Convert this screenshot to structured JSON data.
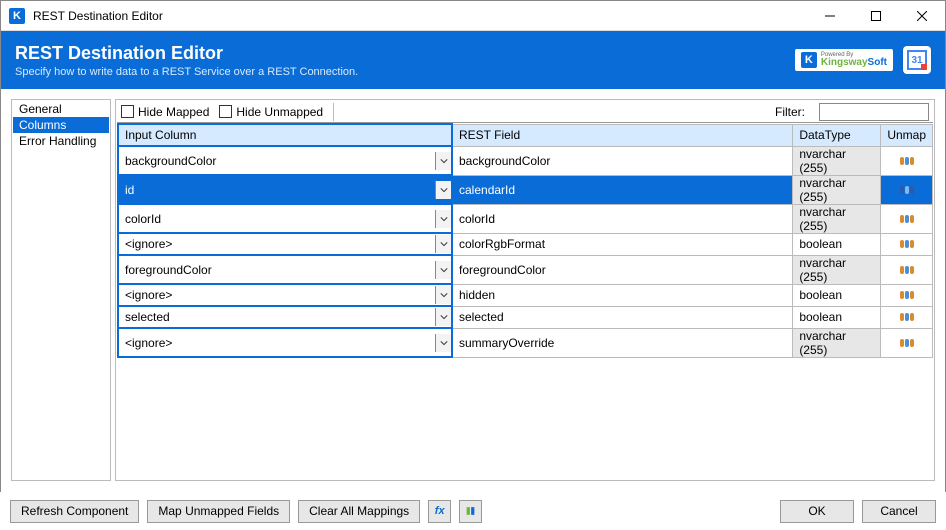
{
  "window": {
    "title": "REST Destination Editor"
  },
  "header": {
    "title": "REST Destination Editor",
    "subtitle": "Specify how to write data to a REST Service over a REST Connection."
  },
  "brand": {
    "powered_by": "Powered By",
    "name_green": "Kingsway",
    "name_blue": "Soft",
    "calendar_day": "31"
  },
  "sidebar": {
    "items": [
      {
        "label": "General",
        "selected": false
      },
      {
        "label": "Columns",
        "selected": true
      },
      {
        "label": "Error Handling",
        "selected": false
      }
    ]
  },
  "toolbar": {
    "hide_mapped": "Hide Mapped",
    "hide_unmapped": "Hide Unmapped",
    "filter_label": "Filter:",
    "filter_value": ""
  },
  "grid": {
    "headers": {
      "input": "Input Column",
      "rest": "REST Field",
      "datatype": "DataType",
      "unmap": "Unmap"
    },
    "rows": [
      {
        "input": "backgroundColor",
        "rest": "backgroundColor",
        "datatype": "nvarchar (255)",
        "dt_pill": true,
        "selected": false
      },
      {
        "input": "id",
        "rest": "calendarId",
        "datatype": "nvarchar (255)",
        "dt_pill": true,
        "selected": true
      },
      {
        "input": "colorId",
        "rest": "colorId",
        "datatype": "nvarchar (255)",
        "dt_pill": true,
        "selected": false
      },
      {
        "input": "<ignore>",
        "rest": "colorRgbFormat",
        "datatype": "boolean",
        "dt_pill": false,
        "selected": false
      },
      {
        "input": "foregroundColor",
        "rest": "foregroundColor",
        "datatype": "nvarchar (255)",
        "dt_pill": true,
        "selected": false
      },
      {
        "input": "<ignore>",
        "rest": "hidden",
        "datatype": "boolean",
        "dt_pill": false,
        "selected": false
      },
      {
        "input": "selected",
        "rest": "selected",
        "datatype": "boolean",
        "dt_pill": false,
        "selected": false
      },
      {
        "input": "<ignore>",
        "rest": "summaryOverride",
        "datatype": "nvarchar (255)",
        "dt_pill": true,
        "selected": false
      }
    ]
  },
  "footer": {
    "refresh": "Refresh Component",
    "map_unmapped": "Map Unmapped Fields",
    "clear_all": "Clear All Mappings",
    "fx": "fx",
    "ok": "OK",
    "cancel": "Cancel"
  }
}
